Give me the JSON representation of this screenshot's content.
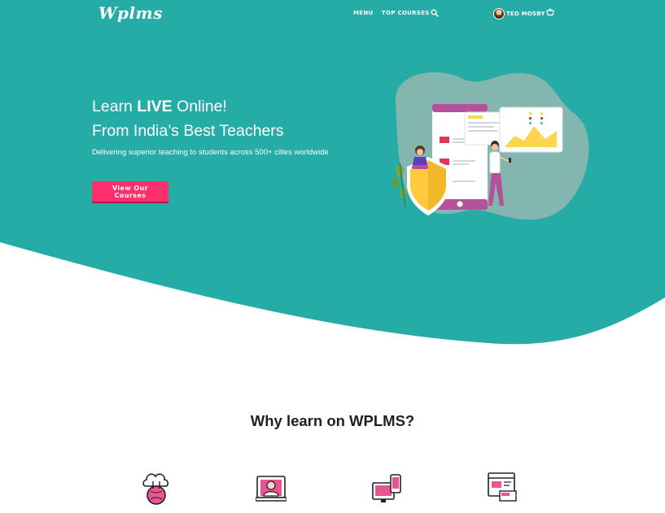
{
  "header": {
    "logo": "Wplms",
    "nav": [
      {
        "label": "MENU"
      },
      {
        "label": "TOP COURSES"
      }
    ],
    "search_icon": "search-icon",
    "user": {
      "name": "TED MOSBY"
    },
    "cart_icon": "cart-icon"
  },
  "hero": {
    "title_prefix": "Learn ",
    "title_bold": "LIVE",
    "title_suffix": " Online!",
    "title_line2": "From India’s Best Teachers",
    "subtitle": "Delivering superior teaching to students across 500+ cities worldwide",
    "cta_label": "View Our Courses"
  },
  "section": {
    "title": "Why learn on WPLMS?",
    "features": [
      {
        "icon": "cloud-globe-icon"
      },
      {
        "icon": "online-tutor-icon"
      },
      {
        "icon": "multi-device-icon"
      },
      {
        "icon": "web-editor-icon"
      }
    ]
  },
  "colors": {
    "teal": "#26aca6",
    "accent": "#ff2e6d",
    "heading": "#1f1f1f"
  }
}
